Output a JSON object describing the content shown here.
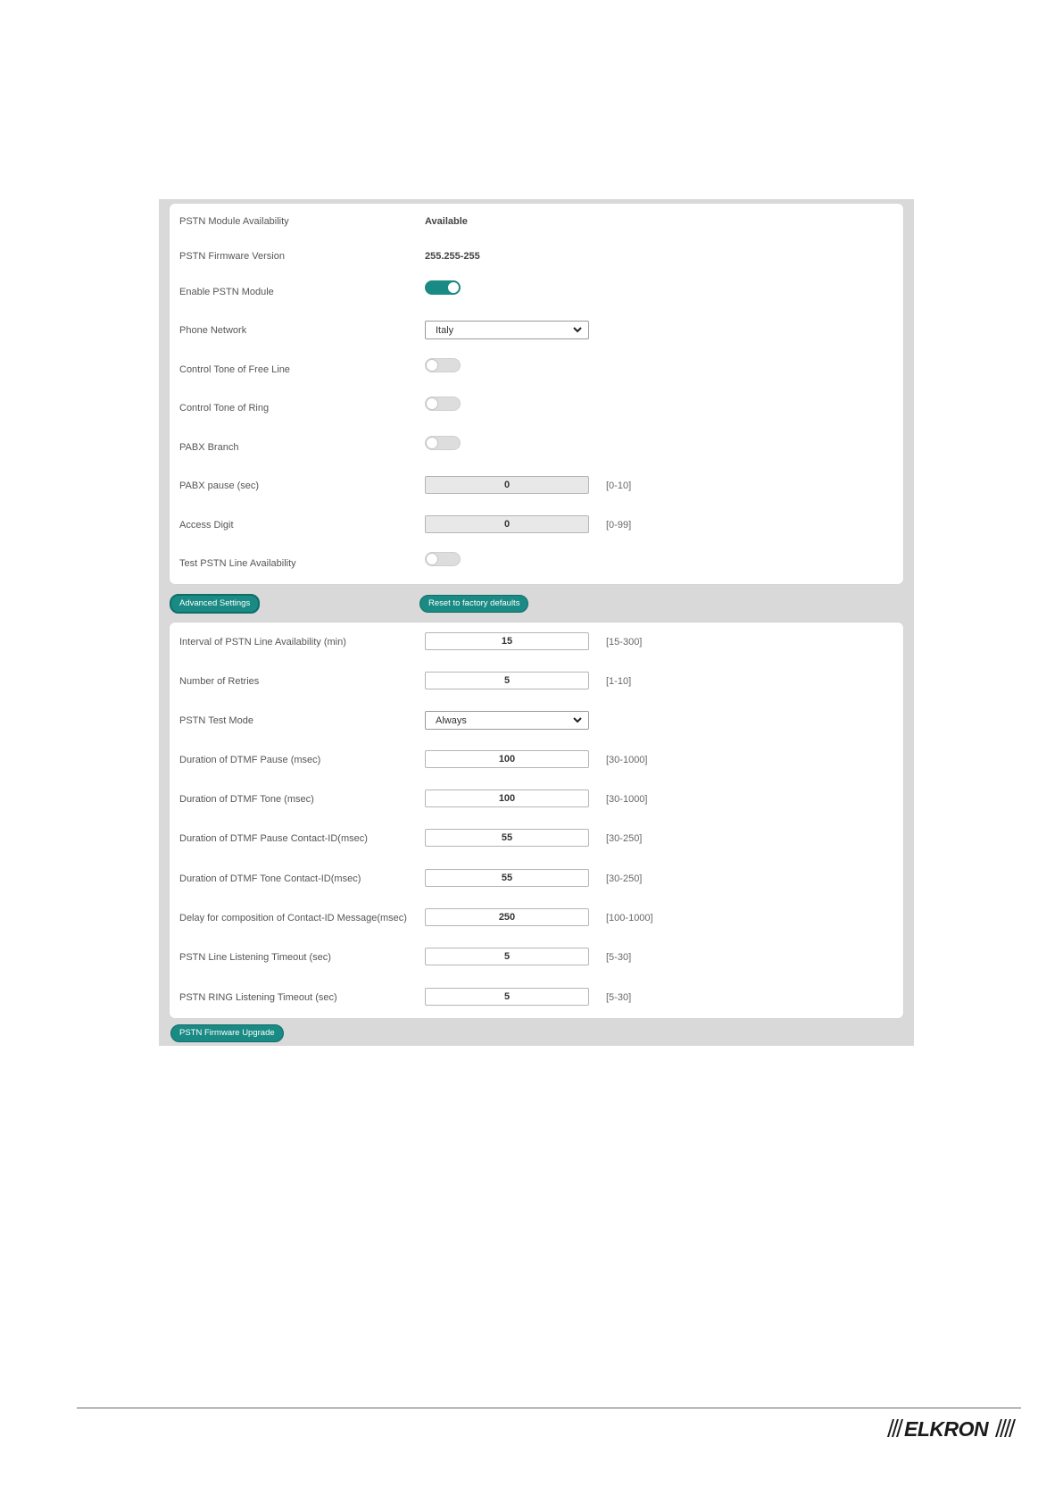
{
  "main_settings": {
    "rows": [
      {
        "label": "PSTN Module Availability",
        "type": "text",
        "value": "Available"
      },
      {
        "label": "PSTN Firmware Version",
        "type": "text",
        "value": "255.255-255"
      },
      {
        "label": "Enable PSTN Module",
        "type": "toggle",
        "on": true
      },
      {
        "label": "Phone Network",
        "type": "select",
        "value": "Italy"
      },
      {
        "label": "Control Tone of Free Line",
        "type": "toggle",
        "on": false
      },
      {
        "label": "Control Tone of Ring",
        "type": "toggle",
        "on": false
      },
      {
        "label": "PABX Branch",
        "type": "toggle",
        "on": false
      },
      {
        "label": "PABX pause (sec)",
        "type": "input-disabled",
        "value": "0",
        "range": "[0-10]"
      },
      {
        "label": "Access Digit",
        "type": "input-disabled",
        "value": "0",
        "range": "[0-99]"
      },
      {
        "label": "Test PSTN Line Availability",
        "type": "toggle",
        "on": false
      }
    ]
  },
  "buttons": {
    "advanced": "Advanced Settings",
    "reset": "Reset to factory defaults",
    "firmware": "PSTN Firmware Upgrade"
  },
  "advanced_settings": {
    "rows": [
      {
        "label": "Interval of PSTN Line Availability (min)",
        "type": "input",
        "value": "15",
        "range": "[15-300]"
      },
      {
        "label": "Number of Retries",
        "type": "input",
        "value": "5",
        "range": "[1-10]"
      },
      {
        "label": "PSTN Test Mode",
        "type": "select",
        "value": "Always"
      },
      {
        "label": "Duration of DTMF Pause (msec)",
        "type": "input",
        "value": "100",
        "range": "[30-1000]"
      },
      {
        "label": "Duration of DTMF Tone (msec)",
        "type": "input",
        "value": "100",
        "range": "[30-1000]"
      },
      {
        "label": "Duration of DTMF Pause Contact-ID(msec)",
        "type": "input",
        "value": "55",
        "range": "[30-250]"
      },
      {
        "label": "Duration of DTMF Tone Contact-ID(msec)",
        "type": "input",
        "value": "55",
        "range": "[30-250]"
      },
      {
        "label": "Delay for composition of Contact-ID Message(msec)",
        "type": "input",
        "value": "250",
        "range": "[100-1000]"
      },
      {
        "label": "PSTN Line Listening Timeout (sec)",
        "type": "input",
        "value": "5",
        "range": "[5-30]"
      },
      {
        "label": "PSTN RING Listening Timeout (sec)",
        "type": "input",
        "value": "5",
        "range": "[5-30]"
      }
    ]
  },
  "footer": {
    "logo_text": "ELKRON"
  },
  "colors": {
    "accent": "#1a8a84",
    "frame": "#d9d9d9"
  }
}
